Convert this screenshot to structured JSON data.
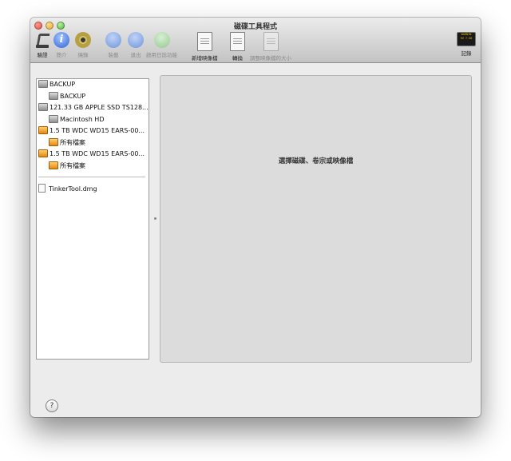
{
  "window": {
    "title": "磁碟工具程式"
  },
  "toolbar": {
    "items": [
      {
        "label": "驗證",
        "icon": "verify-icon",
        "enabled": true
      },
      {
        "label": "簡介",
        "icon": "info-icon",
        "enabled": false
      },
      {
        "label": "燒錄",
        "icon": "burn-icon",
        "enabled": false
      },
      {
        "label": "裝載",
        "icon": "mount-icon",
        "enabled": false
      },
      {
        "label": "退出",
        "icon": "eject-icon",
        "enabled": false
      },
      {
        "label": "啟用日誌功能",
        "icon": "journal-icon",
        "enabled": false
      },
      {
        "label": "新增映像檔",
        "icon": "new-image-icon",
        "enabled": true
      },
      {
        "label": "轉換",
        "icon": "convert-icon",
        "enabled": true
      },
      {
        "label": "調整映像檔的大小",
        "icon": "resize-image-icon",
        "enabled": false
      }
    ],
    "log": {
      "label": "記錄",
      "icon": "log-icon",
      "icon_text": [
        "WARNIN",
        "9V 7:36"
      ]
    }
  },
  "sidebar": {
    "items": [
      {
        "label": "BACKUP",
        "icon": "internal-disk-icon",
        "level": 0
      },
      {
        "label": "BACKUP",
        "icon": "volume-icon",
        "level": 1
      },
      {
        "label": "121.33 GB APPLE SSD TS128...",
        "icon": "internal-disk-icon",
        "level": 0
      },
      {
        "label": "Macintosh HD",
        "icon": "volume-icon",
        "level": 1
      },
      {
        "label": "1.5 TB WDC WD15 EARS-00...",
        "icon": "external-disk-icon",
        "level": 0
      },
      {
        "label": "所有檔案",
        "icon": "external-volume-icon",
        "level": 1
      },
      {
        "label": "1.5 TB WDC WD15 EARS-00...",
        "icon": "external-disk-icon",
        "level": 0
      },
      {
        "label": "所有檔案",
        "icon": "external-volume-icon",
        "level": 1
      }
    ],
    "images": [
      {
        "label": "TinkerTool.dmg",
        "icon": "dmg-file-icon"
      }
    ]
  },
  "main": {
    "message": "選擇磁碟、卷宗或映像檔"
  },
  "help": {
    "label": "?"
  }
}
